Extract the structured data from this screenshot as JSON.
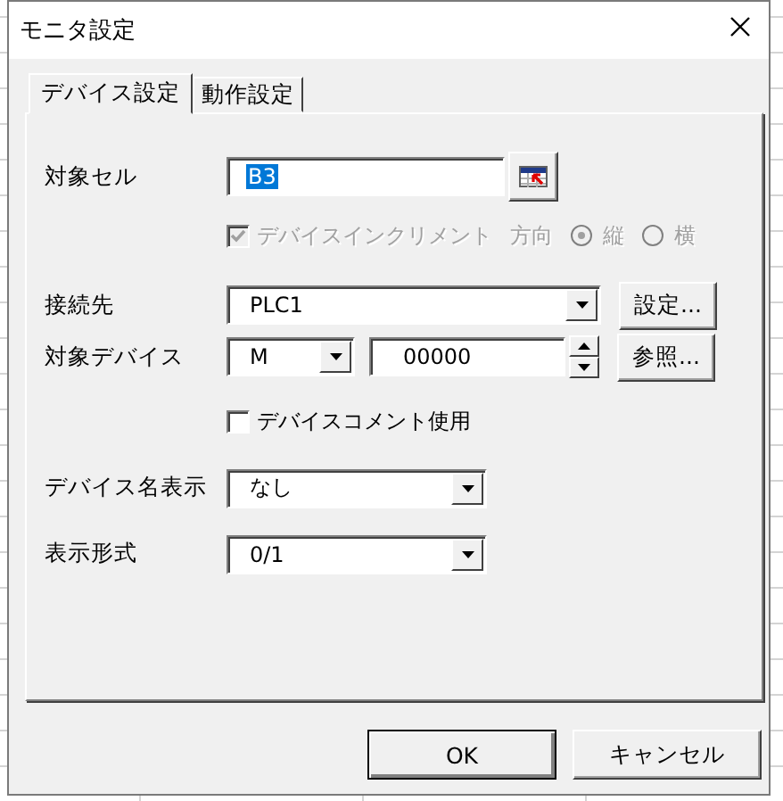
{
  "window": {
    "title": "モニタ設定"
  },
  "tabs": [
    {
      "label": "デバイス設定",
      "selected": true
    },
    {
      "label": "動作設定",
      "selected": false
    }
  ],
  "target_cell": {
    "label": "対象セル",
    "value": "B3",
    "text_selected": true
  },
  "increment": {
    "label": "デバイスインクリメント",
    "checked": true,
    "disabled": true
  },
  "direction": {
    "label": "方向",
    "disabled": true,
    "options": [
      {
        "label": "縦",
        "selected": true
      },
      {
        "label": "横",
        "selected": false
      }
    ]
  },
  "connection": {
    "label": "接続先",
    "value": "PLC1",
    "button": "設定..."
  },
  "target_device": {
    "label": "対象デバイス",
    "type": "M",
    "number": "00000",
    "button": "参照..."
  },
  "device_comment": {
    "label": "デバイスコメント使用",
    "checked": false,
    "disabled": false
  },
  "device_name_display": {
    "label": "デバイス名表示",
    "value": "なし"
  },
  "display_format": {
    "label": "表示形式",
    "value": "0/1"
  },
  "buttons": [
    {
      "label": "OK",
      "default": true
    },
    {
      "label": "キャンセル",
      "default": false
    }
  ]
}
